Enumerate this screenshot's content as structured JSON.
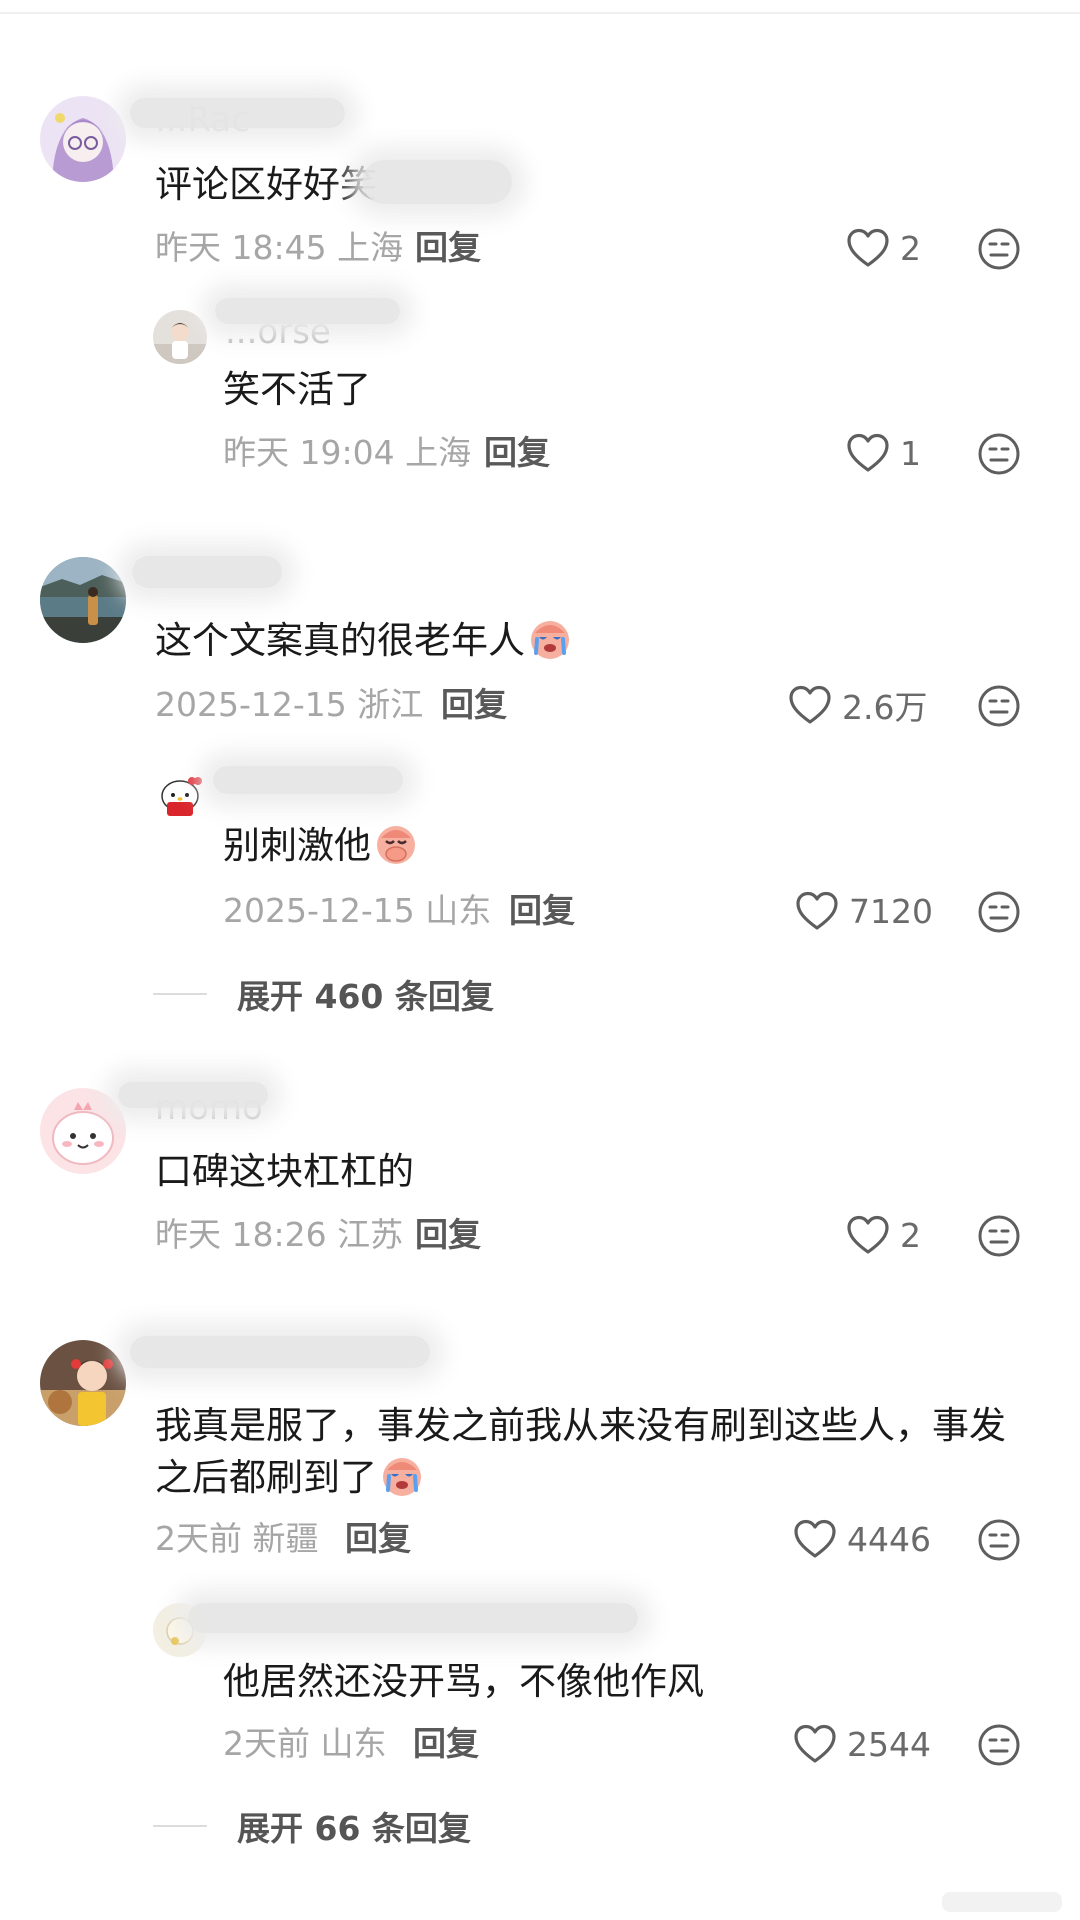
{
  "comments": [
    {
      "username": "...Rac",
      "text": "评论区好好笑",
      "time": "昨天 18:45",
      "location": "上海",
      "reply": "回复",
      "likes": "2",
      "replies": [
        {
          "username": "...orse",
          "text": "笑不活了",
          "time": "昨天 19:04",
          "location": "上海",
          "reply": "回复",
          "likes": "1"
        }
      ]
    },
    {
      "username": "",
      "text": "这个文案真的很老年人",
      "emoji": "crying-face-emoji",
      "time": "2025-12-15",
      "location": "浙江",
      "reply": "回复",
      "likes": "2.6万",
      "replies": [
        {
          "username": "",
          "text": "别刺激他",
          "emoji": "covering-mouth-emoji",
          "time": "2025-12-15",
          "location": "山东",
          "reply": "回复",
          "likes": "7120"
        }
      ],
      "expand": "展开 460 条回复"
    },
    {
      "username": "momo",
      "text": "口碑这块杠杠的",
      "time": "昨天 18:26",
      "location": "江苏",
      "reply": "回复",
      "likes": "2"
    },
    {
      "username": "",
      "text_line1": "我真是服了，事发之前我从来没有刷到这些人，事发",
      "text_line2": "之后都刷到了",
      "emoji": "crying-face-emoji",
      "time": "2天前",
      "location": "新疆",
      "reply": "回复",
      "likes": "4446",
      "replies": [
        {
          "username": "",
          "text": "他居然还没开骂，不像他作风",
          "time": "2天前",
          "location": "山东",
          "reply": "回复",
          "likes": "2544"
        }
      ],
      "expand": "展开 66 条回复"
    }
  ],
  "colors": {
    "text": "#1a1a1a",
    "meta": "#a6a6a6",
    "reply": "#595959",
    "icon": "#6a6a6a"
  }
}
